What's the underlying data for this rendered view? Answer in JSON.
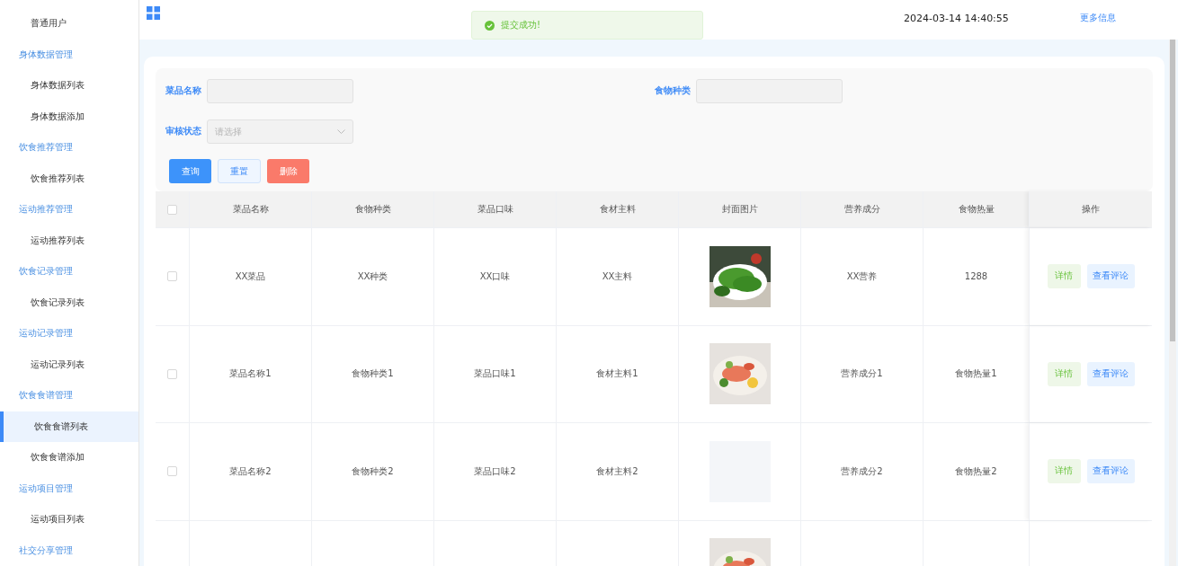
{
  "sidebar": {
    "items": [
      {
        "kind": "item",
        "label": "普通用户",
        "selected": false
      },
      {
        "kind": "group",
        "label": "身体数据管理"
      },
      {
        "kind": "item",
        "label": "身体数据列表",
        "selected": false
      },
      {
        "kind": "item",
        "label": "身体数据添加",
        "selected": false
      },
      {
        "kind": "group",
        "label": "饮食推荐管理"
      },
      {
        "kind": "item",
        "label": "饮食推荐列表",
        "selected": false
      },
      {
        "kind": "group",
        "label": "运动推荐管理"
      },
      {
        "kind": "item",
        "label": "运动推荐列表",
        "selected": false
      },
      {
        "kind": "group",
        "label": "饮食记录管理"
      },
      {
        "kind": "item",
        "label": "饮食记录列表",
        "selected": false
      },
      {
        "kind": "group",
        "label": "运动记录管理"
      },
      {
        "kind": "item",
        "label": "运动记录列表",
        "selected": false
      },
      {
        "kind": "group",
        "label": "饮食食谱管理"
      },
      {
        "kind": "item",
        "label": "饮食食谱列表",
        "selected": true
      },
      {
        "kind": "item",
        "label": "饮食食谱添加",
        "selected": false
      },
      {
        "kind": "group",
        "label": "运动项目管理"
      },
      {
        "kind": "item",
        "label": "运动项目列表",
        "selected": false
      },
      {
        "kind": "group",
        "label": "社交分享管理"
      }
    ]
  },
  "header": {
    "datetime": "2024-03-14 14:40:55",
    "more_link": "更多信息"
  },
  "toast": {
    "message": "提交成功!"
  },
  "filters": {
    "fields": [
      {
        "kind": "input",
        "label": "菜品名称"
      },
      {
        "kind": "input",
        "label": "食物种类"
      },
      {
        "kind": "select",
        "label": "审核状态",
        "placeholder": "请选择"
      }
    ],
    "buttons": [
      {
        "kind": "primary",
        "label": "查询"
      },
      {
        "kind": "plain",
        "label": "重置"
      },
      {
        "kind": "danger",
        "label": "删除"
      }
    ]
  },
  "table": {
    "select_all_checked": false,
    "columns": [
      "菜品名称",
      "食物种类",
      "菜品口味",
      "食材主料",
      "封面图片",
      "营养成分",
      "食物热量",
      "操作"
    ],
    "rows": [
      {
        "checked": false,
        "cells": [
          "XX菜品",
          "XX种类",
          "XX口味",
          "XX主料"
        ],
        "cover": {
          "kind": "picture"
        },
        "cells_after": [
          "XX营养",
          "1288"
        ],
        "actions": [
          "详情",
          "查看评论"
        ]
      },
      {
        "checked": false,
        "cells": [
          "菜品名称1",
          "食物种类1",
          "菜品口味1",
          "食材主料1"
        ],
        "cover": {
          "kind": "picture"
        },
        "cells_after": [
          "营养成分1",
          "食物热量1"
        ],
        "actions": [
          "详情",
          "查看评论"
        ]
      },
      {
        "checked": false,
        "cells": [
          "菜品名称2",
          "食物种类2",
          "菜品口味2",
          "食材主料2"
        ],
        "cover": {
          "kind": "empty"
        },
        "cells_after": [
          "营养成分2",
          "食物热量2"
        ],
        "actions": [
          "详情",
          "查看评论"
        ]
      },
      {
        "cover": {
          "kind": "picture"
        }
      }
    ]
  }
}
